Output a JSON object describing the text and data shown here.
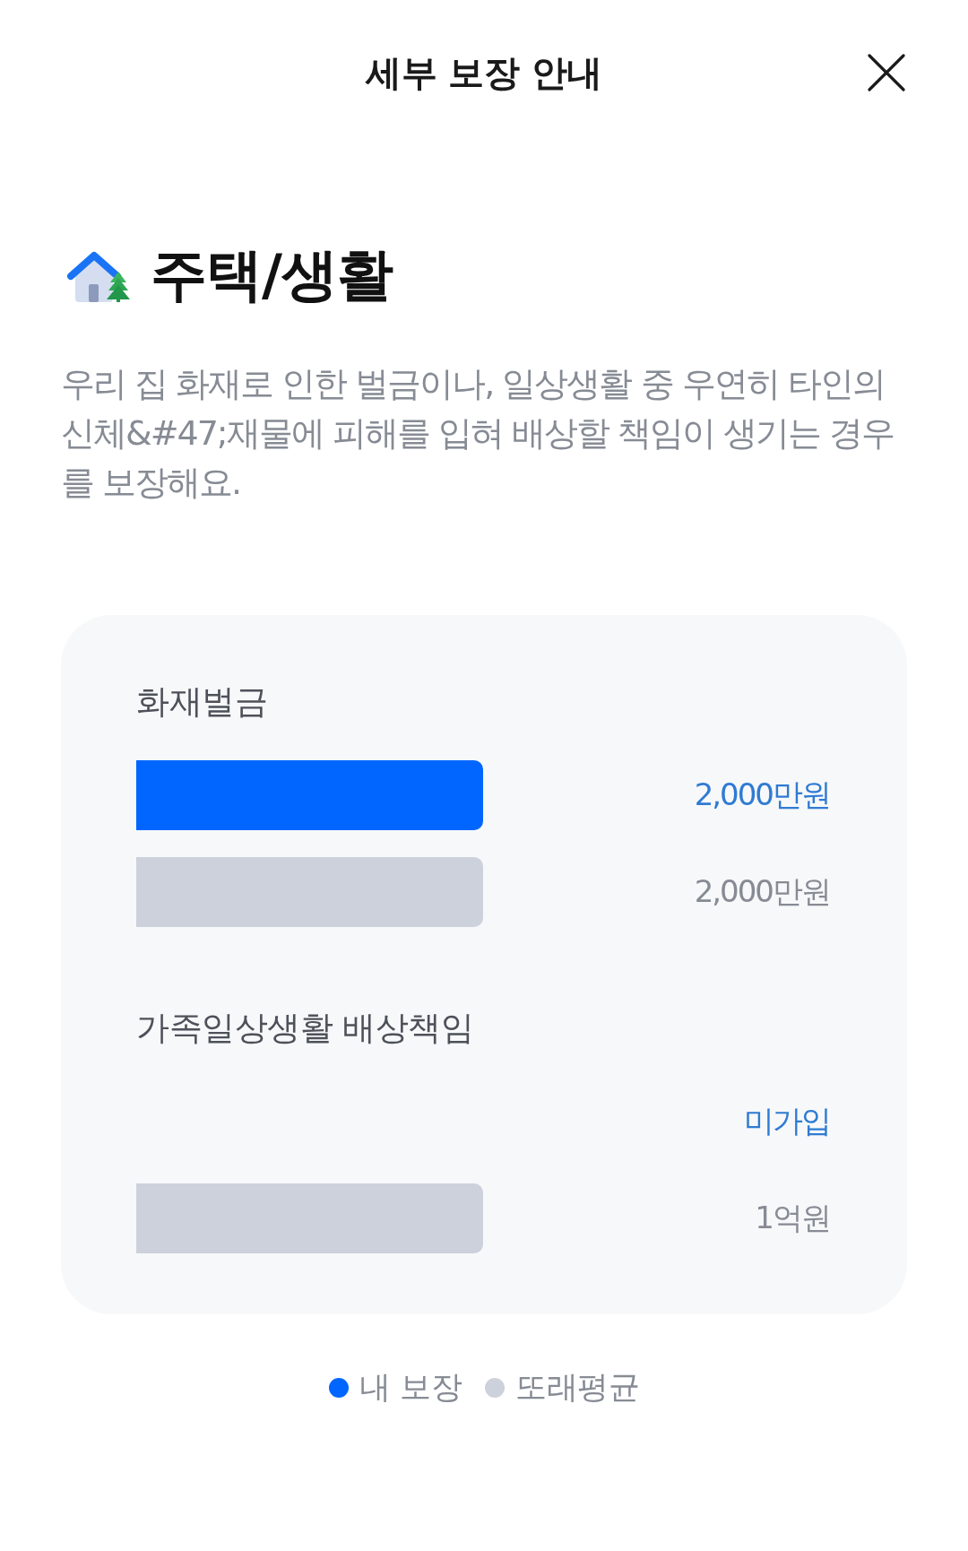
{
  "header": {
    "title": "세부 보장 안내"
  },
  "category": {
    "title": "주택/생활",
    "description": "우리 집 화재로 인한 벌금이나, 일상생활 중 우연히 타인의 신체&#47;재물에 피해를 입혀 배상할 책임이 생기는 경우를 보장해요."
  },
  "sections": [
    {
      "title": "화재벌금",
      "rows": [
        {
          "kind": "mine",
          "level": 1,
          "value": "2,000만원"
        },
        {
          "kind": "average",
          "level": 1,
          "value": "2,000만원"
        }
      ]
    },
    {
      "title": "가족일상생활 배상책임",
      "rows": [
        {
          "kind": "mine",
          "value": "미가입"
        },
        {
          "kind": "average",
          "level": 1,
          "value": "1억원"
        }
      ]
    }
  ],
  "legend": [
    {
      "label": "내 보장",
      "color": "#0066ff"
    },
    {
      "label": "또래평균",
      "color": "#cdd1db"
    }
  ]
}
